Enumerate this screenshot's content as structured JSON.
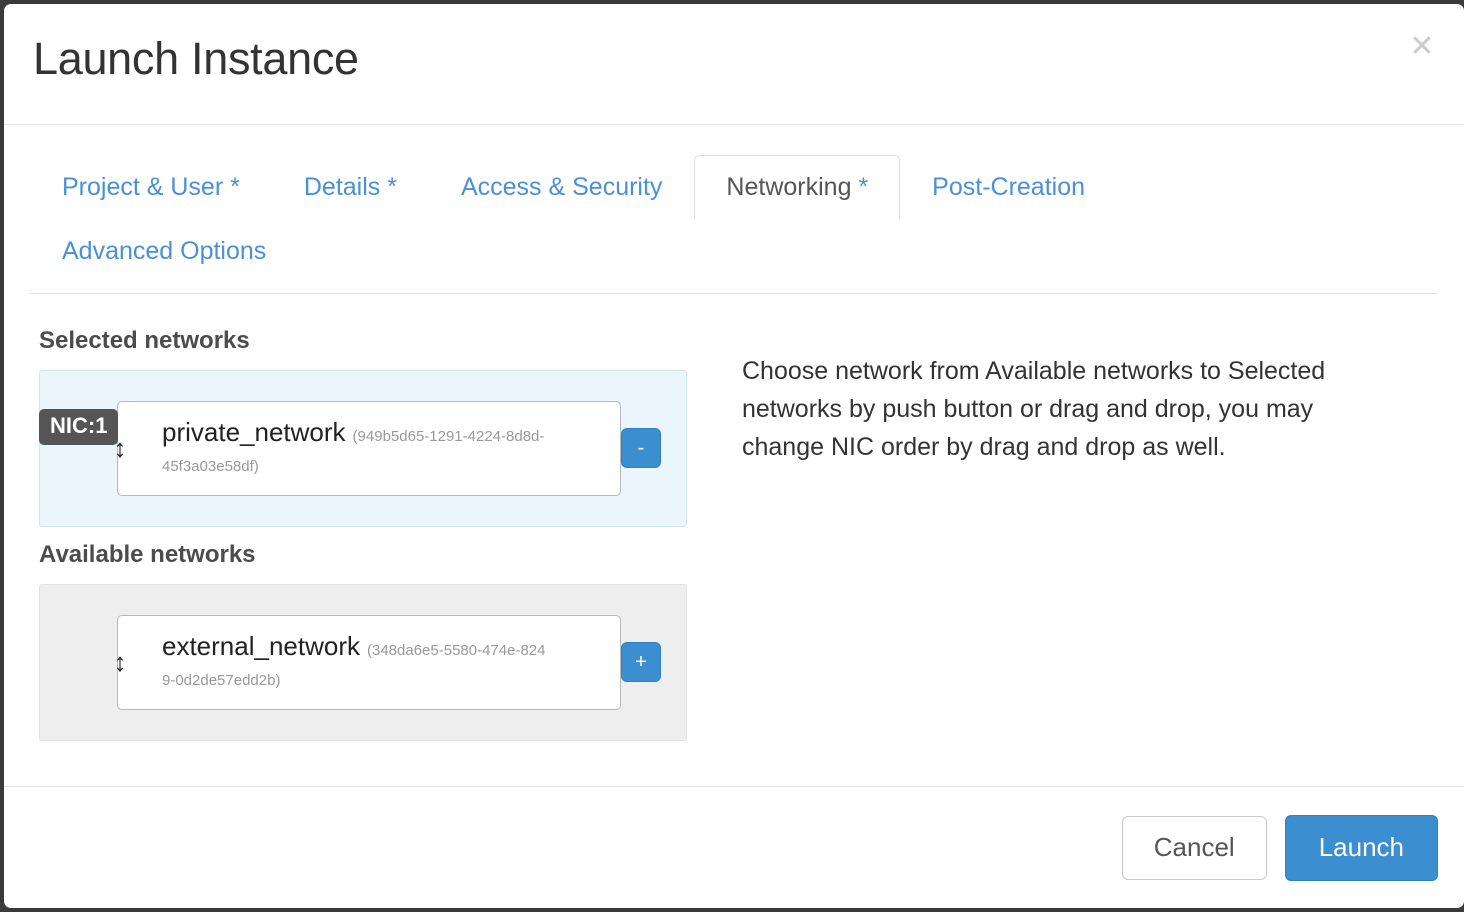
{
  "dialog": {
    "title": "Launch Instance",
    "close_icon": "close-icon",
    "close_glyph": "✕"
  },
  "tabs": [
    {
      "label": "Project & User",
      "required": "*",
      "active": false
    },
    {
      "label": "Details",
      "required": "*",
      "active": false
    },
    {
      "label": "Access & Security",
      "required": "",
      "active": false
    },
    {
      "label": "Networking",
      "required": "*",
      "active": true
    },
    {
      "label": "Post-Creation",
      "required": "",
      "active": false
    },
    {
      "label": "Advanced Options",
      "required": "",
      "active": false
    }
  ],
  "body": {
    "selected_heading": "Selected networks",
    "available_heading": "Available networks",
    "help_text": "Choose network from Available networks to Selected networks by push button or drag and drop, you may change NIC order by drag and drop as well.",
    "drag_handle_glyph": "↕",
    "selected_networks": [
      {
        "nic_badge": "NIC:1",
        "name": "private_network",
        "uuid": "(949b5d65-1291-4224-8d8d-45f3a03e58df)",
        "action_label": "-",
        "action_icon": "minus-icon"
      }
    ],
    "available_networks": [
      {
        "name": "external_network",
        "uuid": "(348da6e5-5580-474e-8249-0d2de57edd2b)",
        "action_label": "+",
        "action_icon": "plus-icon"
      }
    ]
  },
  "footer": {
    "cancel_label": "Cancel",
    "launch_label": "Launch"
  },
  "colors": {
    "accent": "#3b8ed0",
    "link": "#4a90d9",
    "selected_panel_bg": "#eaf6fc",
    "available_panel_bg": "#eeeeee",
    "badge_bg": "#555555",
    "title_text": "#333333"
  }
}
